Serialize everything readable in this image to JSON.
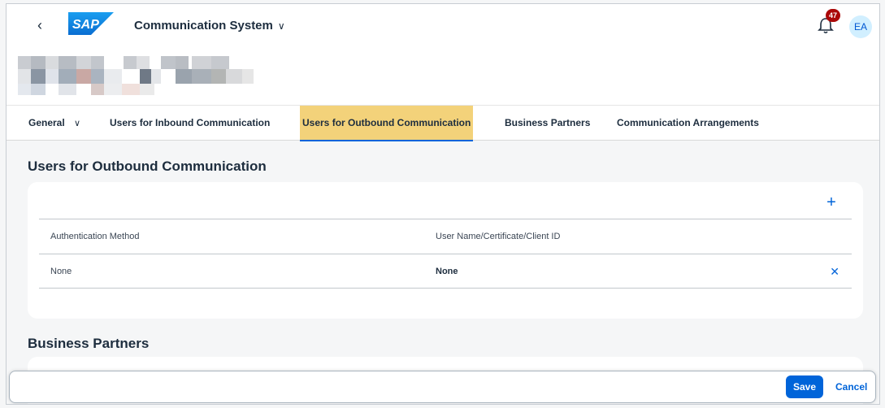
{
  "shellbar": {
    "app_title": "Communication System",
    "notification_count": "47",
    "avatar_initials": "EA"
  },
  "tabs": [
    {
      "label": "General"
    },
    {
      "label": "Users for Inbound Communication"
    },
    {
      "label": "Users for Outbound Communication"
    },
    {
      "label": "Business Partners"
    },
    {
      "label": "Communication Arrangements"
    }
  ],
  "outbound": {
    "title": "Users for Outbound Communication",
    "columns": [
      "Authentication Method",
      "User Name/Certificate/Client ID"
    ],
    "rows": [
      {
        "method": "None",
        "user": "None"
      }
    ]
  },
  "business_partners": {
    "title": "Business Partners"
  },
  "footer": {
    "save_label": "Save",
    "cancel_label": "Cancel"
  },
  "colors": {
    "accent": "#0064d9",
    "active_tab_bg": "#f3d27a",
    "badge": "#aa0808"
  }
}
